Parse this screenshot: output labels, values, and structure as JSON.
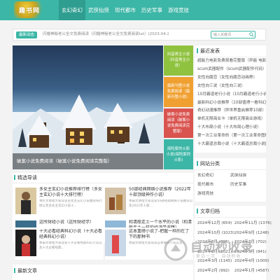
{
  "colors": {
    "accent": "#3cb6a6",
    "tile1": "#8fc23f",
    "tile2": "#f0a030",
    "tile3": "#d9534f",
    "tile4": "#3cb6a6"
  },
  "header": {
    "logo_text": "趣书网",
    "nav": [
      "玄幻奇幻",
      "武侠仙侠",
      "现代都市",
      "历史军事",
      "游戏竞技"
    ]
  },
  "notice": {
    "tag": "最新动态",
    "text": "闪婚神秘老公全文免费阅读（闪婚神秘老公全文免费阅读txt）(2023-04-22)",
    "search_placeholder": "输入关键词"
  },
  "hero": {
    "caption": "破案小说免费阅读（破案小说免费阅读完整版）"
  },
  "tiles": [
    "抖音男主小说（抖音男主小说）",
    "最新刊登小说免费阅读（最新刊登小说）",
    "破案小说免费阅读（破案小说免费阅读完整版）",
    "探险家的火影小说(探险家的火影)"
  ],
  "featured": {
    "title": "精选导读",
    "items": [
      {
        "title": "多女主玄幻小说推荐排行榜（多女主玄幻小说十大排行榜）",
        "desc": "本栏文章给大家谈谈多女主玄幻小说推荐排行榜以及多女主玄幻小说十..."
      },
      {
        "title": "50部经典网络小说推荐（2022年十部顶级神作小说）",
        "desc": "本篇文章给大家谈谈50部经典网络小说推荐以及2022年十部..."
      },
      {
        "title": "这所财经小说（这所财经学）",
        "desc": "本篇文章给大家谈谈这所财经小说，以及这所财经学对应的知识点..."
      },
      {
        "title": "和清般走土一个水平的小说（和清般走土一样的经济学书籍）",
        "desc": "本篇文章给大家谈谈和清般走土一个水平的小说，以及..."
      },
      {
        "title": "十大必看经典科幻小说（十大必看经典科幻小说）",
        "desc": "本篇文章给大家谈谈十大必看经典科幻小说以及十大必看经典..."
      },
      {
        "title": "这本重磅小说了-把握一样的在了下的那种书",
        "desc": "本篇文章给大家谈谈这本重磅小说以及..."
      }
    ]
  },
  "latest": {
    "title": "最新文章"
  },
  "sidebar": {
    "recent_title": "最近发表",
    "recent": [
      "超能力电影免费观看完整版（异能 电影）",
      "scum武器配件（scum武器配件代码）",
      "女性向腐恋（女性向腐恋动画界）",
      "女性向三说（女性向三说）",
      "10月霸道老行小说（10月霸道老行小说）",
      "最新科幻小说推荐（10部值得一看科幻小说）",
      "奇幻动漫推荐（异世界重启推荐10部）",
      "单机无限商业卡（单机无限商业游戏）",
      "十大布局小说（十大布局心理小说）",
      "第一次工业革命的（第一次工业革命图解）",
      "十大霸道总裁小说（十大霸道总裁小说推荐）"
    ],
    "cats_title": "网站分类",
    "cats": [
      "玄幻奇幻",
      "武侠仙侠",
      "现代都市",
      "历史军事",
      "游戏竞技"
    ],
    "archive_title": "文章归档",
    "archive": [
      "2024年12月 (654)",
      "2024年11月 (1376)",
      "2024年10月 (1023)",
      "2024年9月 (1248)",
      "2024年8月 (896)",
      "2024年7月 (702)",
      "2024年6月 (1021)",
      "2024年5月 (941)",
      "2024年3月 (1145)",
      "2024年4月 (1000)",
      "2024年2月 (992)",
      "2024年1月 (4587)"
    ]
  },
  "watermark": {
    "text": "自动秒收录",
    "sub": "· 来访一次 · 自动秒收 ·"
  }
}
